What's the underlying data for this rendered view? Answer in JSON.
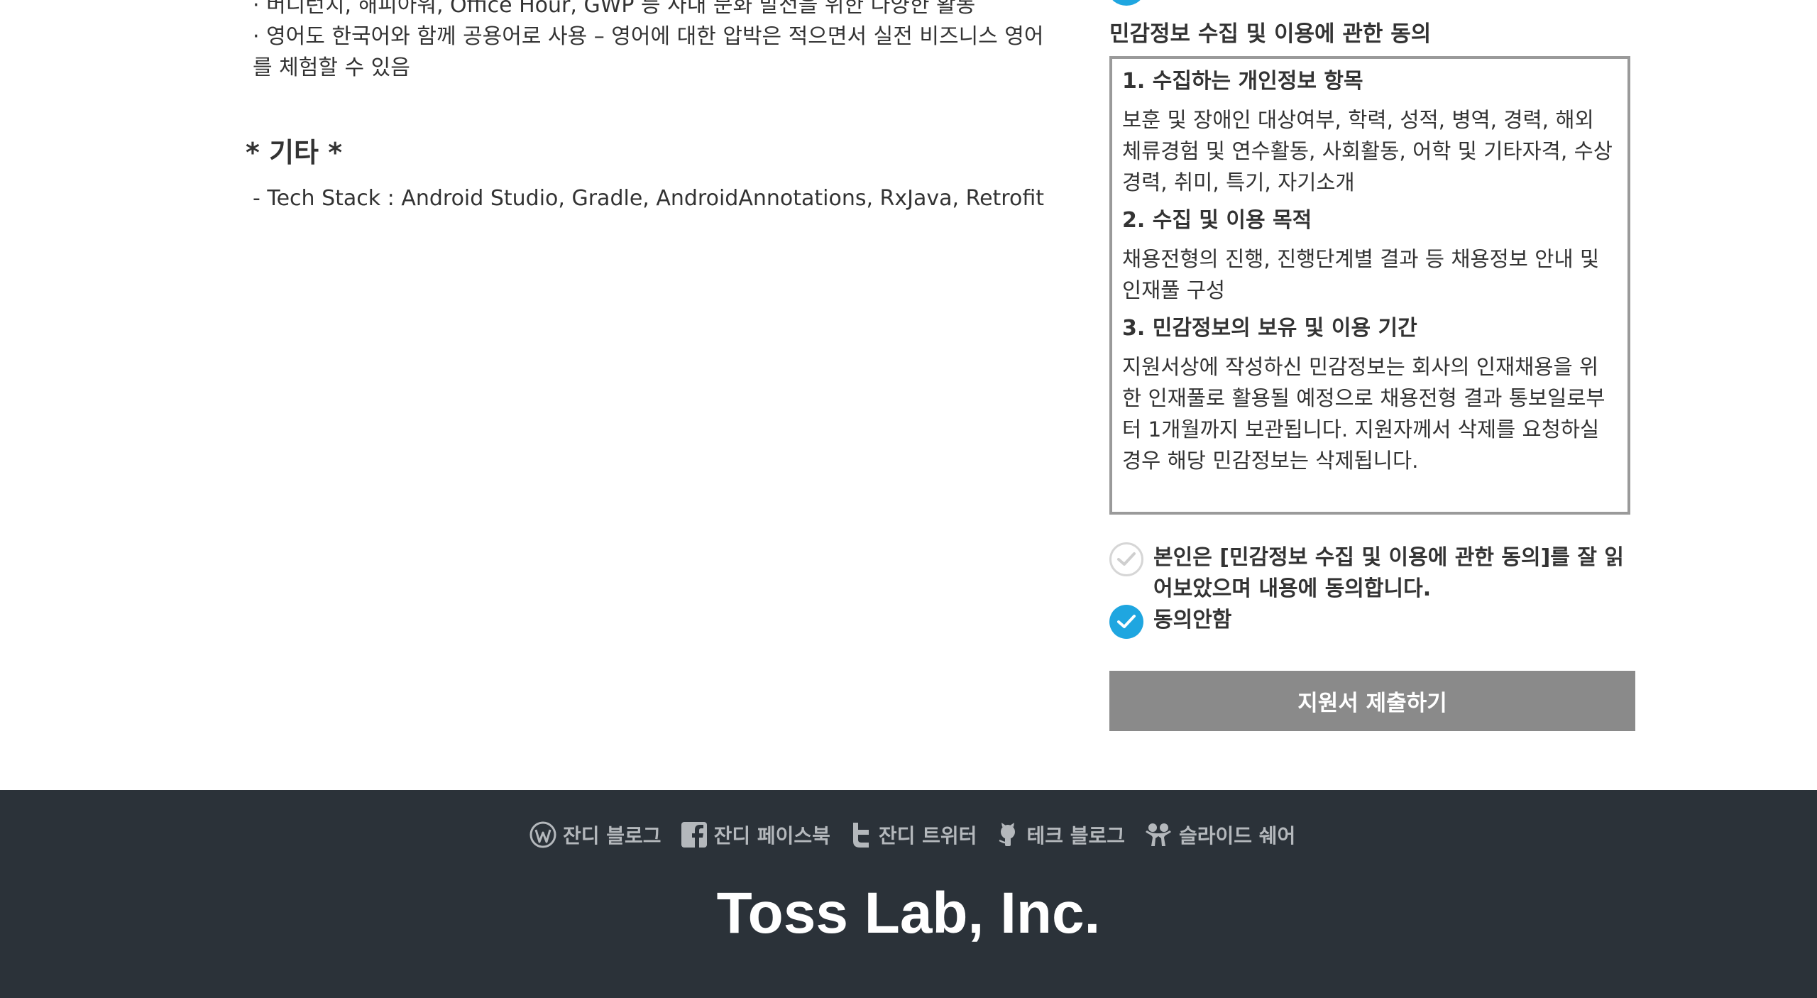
{
  "job": {
    "bullets": [
      "· 버디런치, 해피아워, Office Hour, GWP 등 사내 문화 발전을 위한 다양한 활동",
      "· 영어도 한국어와 함께 공용어로 사용 – 영어에 대한 압박은 적으면서 실전 비즈니스 영어",
      "를 체험할 수 있음"
    ],
    "section_title": "* 기타 *",
    "tech_stack": "- Tech Stack : Android Studio, Gradle, AndroidAnnotations, RxJava, Retrofit"
  },
  "consent": {
    "title": "민감정보 수집 및 이용에 관한 동의",
    "sections": [
      {
        "heading": "1. 수집하는 개인정보 항목",
        "body": "보훈 및 장애인 대상여부, 학력, 성적, 병역, 경력, 해외 체류경험 및 연수활동, 사회활동, 어학 및 기타자격, 수상경력, 취미, 특기, 자기소개"
      },
      {
        "heading": "2. 수집 및 이용 목적",
        "body": "채용전형의 진행, 진행단계별 결과 등 채용정보 안내 및 인재풀 구성"
      },
      {
        "heading": "3. 민감정보의 보유 및 이용 기간",
        "body": "지원서상에 작성하신 민감정보는 회사의 인재채용을 위한 인재풀로 활용될 예정으로 채용전형 결과 통보일로부터 1개월까지 보관됩니다. 지원자께서 삭제를 요청하실 경우 해당 민감정보는 삭제됩니다."
      }
    ],
    "agree_label": "본인은 [민감정보 수집 및 이용에 관한 동의]를 잘 읽어보았으며 내용에 동의합니다.",
    "disagree_label": "동의안함",
    "agree_checked": false,
    "disagree_checked": true
  },
  "submit_label": "지원서 제출하기",
  "footer": {
    "links": [
      {
        "label": "잔디 블로그",
        "icon": "wordpress-icon"
      },
      {
        "label": "잔디 페이스북",
        "icon": "facebook-icon"
      },
      {
        "label": "잔디 트위터",
        "icon": "twitter-icon"
      },
      {
        "label": "테크 블로그",
        "icon": "github-icon"
      },
      {
        "label": "슬라이드 쉐어",
        "icon": "slideshare-icon"
      }
    ],
    "company": "Toss Lab, Inc."
  },
  "colors": {
    "accent": "#1fa6e0",
    "footer_bg": "#2b3239",
    "submit_bg": "#8a8a8a"
  }
}
